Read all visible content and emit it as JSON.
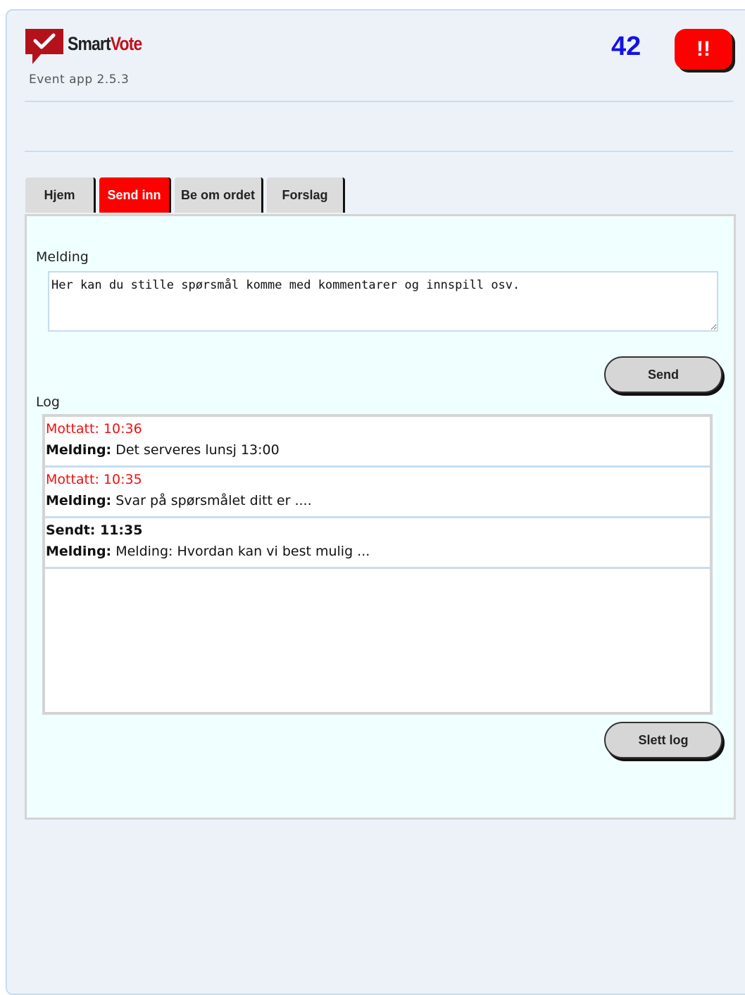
{
  "app": {
    "brand_smart": "Smart",
    "brand_vote": "Vote",
    "version": "Event app 2.5.3",
    "counter": "42",
    "alert_label": "!!"
  },
  "tabs": [
    {
      "label": "Hjem",
      "active": false
    },
    {
      "label": "Send inn",
      "active": true
    },
    {
      "label": "Be om ordet",
      "active": false
    },
    {
      "label": "Forslag",
      "active": false
    }
  ],
  "form": {
    "message_label": "Melding",
    "message_value": "Her kan du stille spørsmål komme med kommentarer og innspill osv.",
    "send_label": "Send"
  },
  "log": {
    "label": "Log",
    "clear_label": "Slett log",
    "entries": [
      {
        "head": "Mottatt: 10:36",
        "type": "received",
        "key": "Melding:",
        "text": "Det serveres lunsj 13:00"
      },
      {
        "head": "Mottatt: 10:35",
        "type": "received",
        "key": "Melding:",
        "text": "Svar på spørsmålet ditt er ...."
      },
      {
        "head": "Sendt: 11:35",
        "type": "sent",
        "key": "Melding:",
        "text": "Melding: Hvordan kan vi best mulig ..."
      }
    ]
  },
  "colors": {
    "accent": "#ff0000",
    "counter": "#1212e8",
    "background": "#edf2f9",
    "panel": "#f0ffff"
  }
}
